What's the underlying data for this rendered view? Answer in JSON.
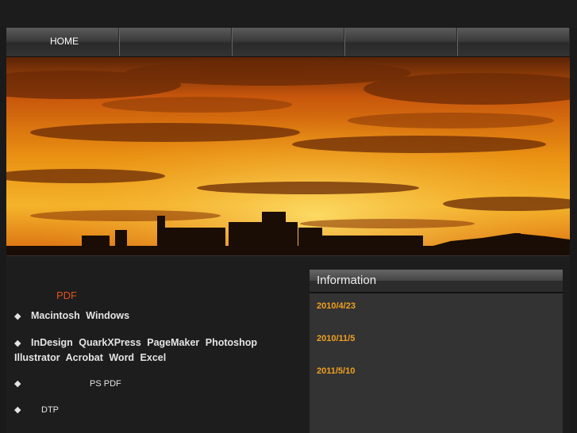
{
  "nav": {
    "items": [
      {
        "label": "HOME"
      },
      {
        "label": ""
      },
      {
        "label": ""
      },
      {
        "label": ""
      },
      {
        "label": ""
      }
    ]
  },
  "hero": {
    "description_icon": "sunset-skyline-image"
  },
  "features": {
    "pdf_link": "PDF",
    "items": [
      {
        "bullet": "◆",
        "text": "Macintosh  Windows"
      },
      {
        "bullet": "◆",
        "text": "InDesign  QuarkXPress  PageMaker  Photoshop  Illustrator  Acrobat  Word  Excel"
      },
      {
        "bullet": "◆",
        "text": "PS    PDF"
      },
      {
        "bullet": "◆",
        "text": "DTP"
      }
    ]
  },
  "information": {
    "title": "Information",
    "dates": [
      "2010/4/23",
      "2010/11/5",
      "2011/5/10"
    ]
  },
  "colors": {
    "accent_orange": "#f0a020",
    "link_red": "#e2541c",
    "background": "#1a1a1a"
  }
}
